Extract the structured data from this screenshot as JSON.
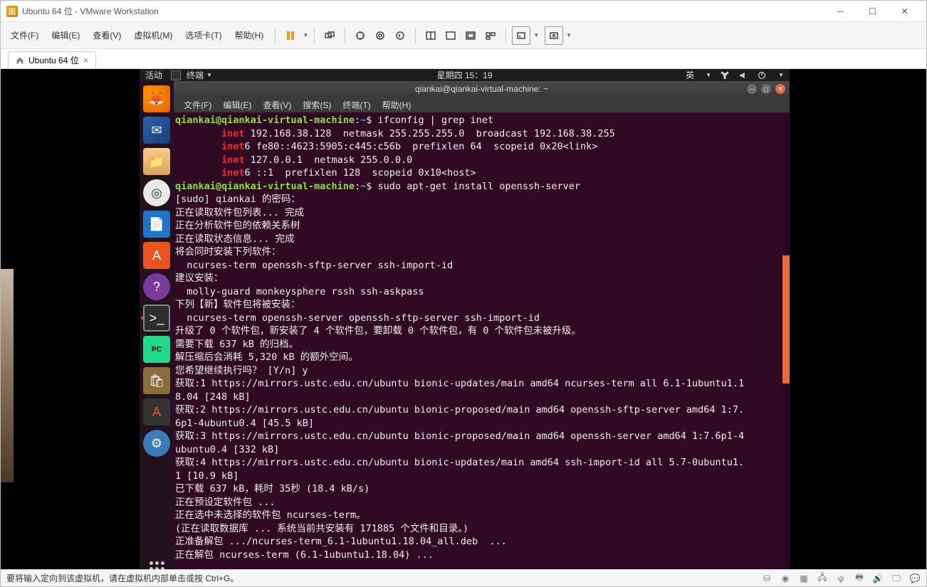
{
  "vmware": {
    "title": "Ubuntu 64 位 - VMware Workstation",
    "menus": [
      "文件(F)",
      "编辑(E)",
      "查看(V)",
      "虚拟机(M)",
      "选项卡(T)",
      "帮助(H)"
    ],
    "tab_label": "Ubuntu 64 位",
    "status_text": "要将输入定向到该虚拟机，请在虚拟机内部单击或按 Ctrl+G。"
  },
  "ubuntu": {
    "activities": "活动",
    "terminal_app": "终端",
    "clock": "星期四 15：19",
    "ime": "英"
  },
  "terminal": {
    "title": "qiankai@qiankai-virtual-machine: ~",
    "menus": [
      "文件(F)",
      "编辑(E)",
      "查看(V)",
      "搜索(S)",
      "终端(T)",
      "帮助(H)"
    ],
    "prompt_user": "qiankai@qiankai-virtual-machine",
    "prompt_path": "~",
    "cmd1": "ifconfig | grep inet",
    "line_inet1a": "inet",
    "line_inet1b": " 192.168.38.128  netmask 255.255.255.0  broadcast 192.168.38.255",
    "line_inet2a": "inet",
    "line_inet2b": "6 fe80::4623:5905:c445:c56b  prefixlen 64  scopeid 0x20<link>",
    "line_inet3a": "inet",
    "line_inet3b": " 127.0.0.1  netmask 255.0.0.0",
    "line_inet4a": "inet",
    "line_inet4b": "6 ::1  prefixlen 128  scopeid 0x10<host>",
    "cmd2": "sudo apt-get install openssh-server",
    "l1": "[sudo] qiankai 的密码：",
    "l2": "正在读取软件包列表... 完成",
    "l3": "正在分析软件包的依赖关系树",
    "l4": "正在读取状态信息... 完成",
    "l5": "将会同时安装下列软件：",
    "l6": "  ncurses-term openssh-sftp-server ssh-import-id",
    "l7": "建议安装：",
    "l8": "  molly-guard monkeysphere rssh ssh-askpass",
    "l9": "下列【新】软件包将被安装：",
    "l10": "  ncurses-term openssh-server openssh-sftp-server ssh-import-id",
    "l11": "升级了 0 个软件包，新安装了 4 个软件包，要卸载 0 个软件包，有 0 个软件包未被升级。",
    "l12": "需要下载 637 kB 的归档。",
    "l13": "解压缩后会消耗 5,320 kB 的额外空间。",
    "l14": "您希望继续执行吗？ [Y/n] y",
    "l15": "获取:1 https://mirrors.ustc.edu.cn/ubuntu bionic-updates/main amd64 ncurses-term all 6.1-1ubuntu1.1",
    "l15b": "8.04 [248 kB]",
    "l16": "获取:2 https://mirrors.ustc.edu.cn/ubuntu bionic-proposed/main amd64 openssh-sftp-server amd64 1:7.",
    "l16b": "6p1-4ubuntu0.4 [45.5 kB]",
    "l17": "获取:3 https://mirrors.ustc.edu.cn/ubuntu bionic-proposed/main amd64 openssh-server amd64 1:7.6p1-4",
    "l17b": "ubuntu0.4 [332 kB]",
    "l18": "获取:4 https://mirrors.ustc.edu.cn/ubuntu bionic-updates/main amd64 ssh-import-id all 5.7-0ubuntu1.",
    "l18b": "1 [10.9 kB]",
    "l19": "已下载 637 kB，耗时 35秒 (18.4 kB/s)",
    "l20": "正在预设定软件包 ...",
    "l21": "正在选中未选择的软件包 ncurses-term。",
    "l22": "(正在读取数据库 ... 系统当前共安装有 171885 个文件和目录。)",
    "l23": "正准备解包 .../ncurses-term_6.1-1ubuntu1.18.04_all.deb  ...",
    "l24": "正在解包 ncurses-term (6.1-1ubuntu1.18.04) ..."
  }
}
